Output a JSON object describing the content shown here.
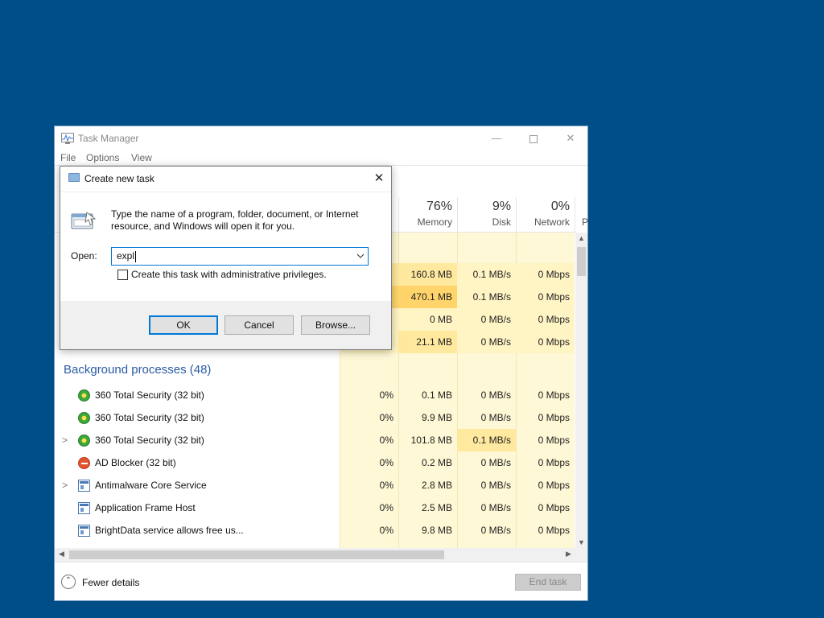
{
  "task_manager": {
    "title": "Task Manager",
    "menu": [
      "File",
      "Options",
      "View"
    ],
    "columns": [
      {
        "pct": "76%",
        "label": "Memory"
      },
      {
        "pct": "9%",
        "label": "Disk"
      },
      {
        "pct": "0%",
        "label": "Network"
      },
      {
        "label": "P"
      }
    ],
    "apps_rows": [
      {
        "cpu": "",
        "mem": "160.8 MB",
        "disk": "0.1 MB/s",
        "net": "0 Mbps"
      },
      {
        "cpu": "",
        "mem": "470.1 MB",
        "disk": "0.1 MB/s",
        "net": "0 Mbps"
      },
      {
        "cpu": "",
        "mem": "0 MB",
        "disk": "0 MB/s",
        "net": "0 Mbps"
      },
      {
        "cpu": "",
        "mem": "21.1 MB",
        "disk": "0 MB/s",
        "net": "0 Mbps"
      }
    ],
    "background_group": "Background processes (48)",
    "processes": [
      {
        "name": "360 Total Security (32 bit)",
        "icon": "shield-360-icon",
        "expand": "",
        "cpu": "0%",
        "mem": "0.1 MB",
        "disk": "0 MB/s",
        "net": "0 Mbps"
      },
      {
        "name": "360 Total Security (32 bit)",
        "icon": "shield-360-icon",
        "expand": "",
        "cpu": "0%",
        "mem": "9.9 MB",
        "disk": "0 MB/s",
        "net": "0 Mbps"
      },
      {
        "name": "360 Total Security (32 bit)",
        "icon": "shield-360-icon",
        "expand": ">",
        "cpu": "0%",
        "mem": "101.8 MB",
        "disk": "0.1 MB/s",
        "net": "0 Mbps"
      },
      {
        "name": "AD Blocker (32 bit)",
        "icon": "ad-blocker-icon",
        "expand": "",
        "cpu": "0%",
        "mem": "0.2 MB",
        "disk": "0 MB/s",
        "net": "0 Mbps"
      },
      {
        "name": "Antimalware Core Service",
        "icon": "service-icon",
        "expand": ">",
        "cpu": "0%",
        "mem": "2.8 MB",
        "disk": "0 MB/s",
        "net": "0 Mbps"
      },
      {
        "name": "Application Frame Host",
        "icon": "service-icon",
        "expand": "",
        "cpu": "0%",
        "mem": "2.5 MB",
        "disk": "0 MB/s",
        "net": "0 Mbps"
      },
      {
        "name": "BrightData service allows free us...",
        "icon": "service-icon",
        "expand": "",
        "cpu": "0%",
        "mem": "9.8 MB",
        "disk": "0 MB/s",
        "net": "0 Mbps"
      }
    ],
    "fewer_details": "Fewer details",
    "end_task": "End task"
  },
  "dialog": {
    "title": "Create new task",
    "message": "Type the name of a program, folder, document, or Internet resource, and Windows will open it for you.",
    "open_label": "Open:",
    "open_value": "expl",
    "admin_checkbox_label": "Create this task with administrative privileges.",
    "admin_checked": false,
    "ok": "OK",
    "cancel": "Cancel",
    "browse": "Browse..."
  }
}
